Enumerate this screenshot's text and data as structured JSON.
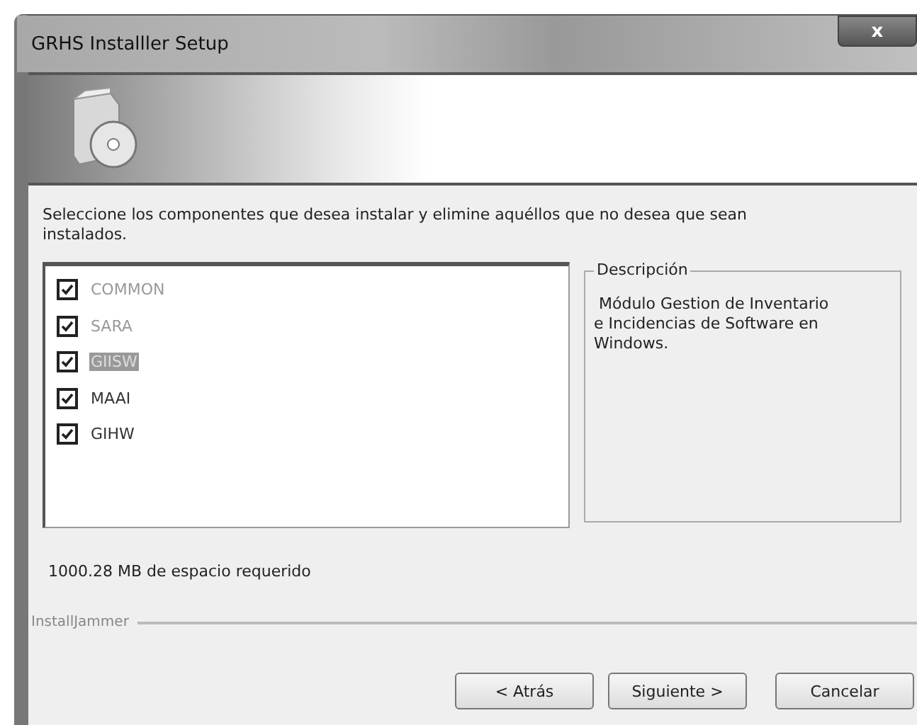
{
  "window": {
    "title": "GRHS Installler Setup",
    "close": "x"
  },
  "instruction": "Seleccione los componentes que desea instalar y elimine aquéllos que no desea que sean instalados.",
  "components": [
    {
      "label": "COMMON",
      "checked": true,
      "disabled": true,
      "selected": false
    },
    {
      "label": "SARA",
      "checked": true,
      "disabled": true,
      "selected": false
    },
    {
      "label": "GIISW",
      "checked": true,
      "disabled": true,
      "selected": true
    },
    {
      "label": "MAAI",
      "checked": true,
      "disabled": false,
      "selected": false
    },
    {
      "label": "GIHW",
      "checked": true,
      "disabled": false,
      "selected": false
    }
  ],
  "description": {
    "title": "Descripción",
    "text": " Módulo Gestion de Inventario e Incidencias de Software en Windows."
  },
  "space_required": "1000.28 MB de espacio requerido",
  "brand": "InstallJammer",
  "buttons": [
    "< Atrás",
    "Siguiente >",
    "Cancelar"
  ]
}
